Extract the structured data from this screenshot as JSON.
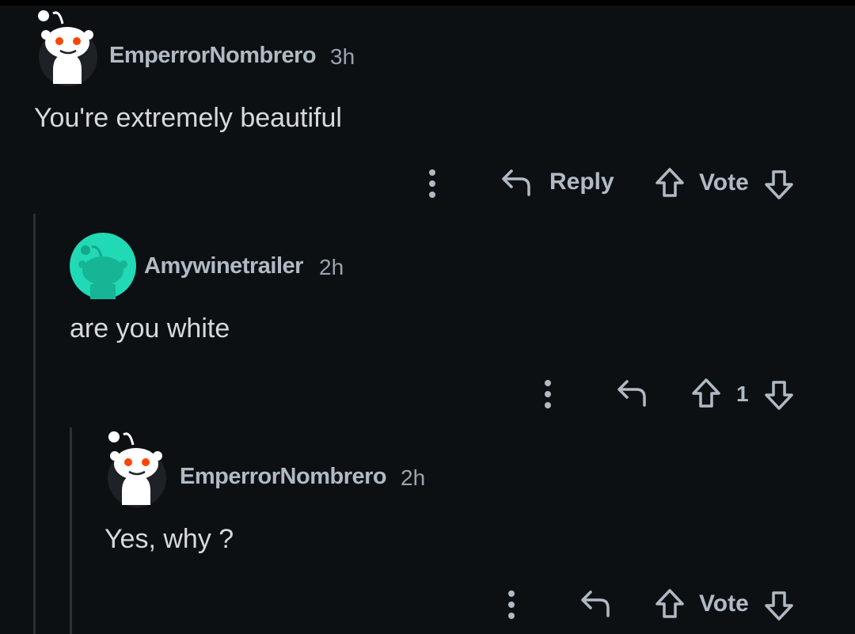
{
  "comments": [
    {
      "username": "EmperrorNombrero",
      "time": "3h",
      "text": "You're extremely beautiful",
      "reply_label": "Reply",
      "vote_label": "Vote"
    },
    {
      "username": "Amywinetrailer",
      "time": "2h",
      "text": "are you white",
      "vote_count": "1"
    },
    {
      "username": "EmperrorNombrero",
      "time": "2h",
      "text": "Yes, why ?",
      "vote_label": "Vote"
    }
  ],
  "colors": {
    "background": "#0d1013",
    "text": "#d7dadc",
    "meta": "#b1bac4",
    "teal_avatar": "#21d9b5",
    "snoo_eye": "#ff4500"
  },
  "icons": [
    "snoo-avatar-icon",
    "more-options-icon",
    "reply-arrow-icon",
    "upvote-arrow-icon",
    "downvote-arrow-icon"
  ]
}
